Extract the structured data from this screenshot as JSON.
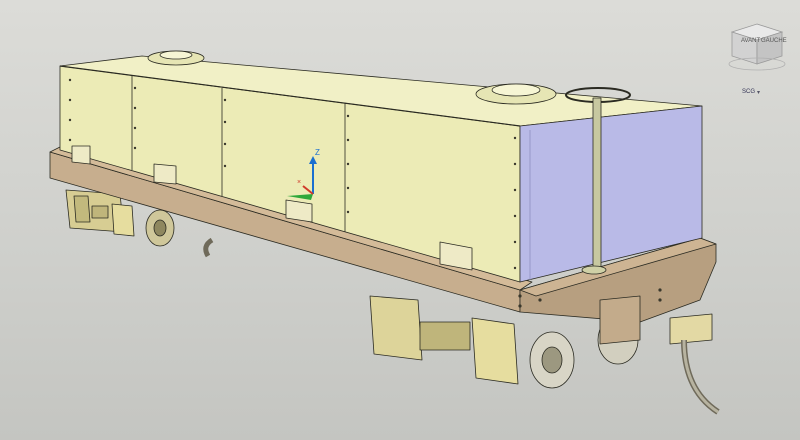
{
  "viewcube": {
    "face_left": "AVANT",
    "face_right": "GAUCHE"
  },
  "wcs_menu": {
    "label": "SCG",
    "chevron": "▾"
  },
  "ucs": {
    "z_label": "Z"
  },
  "icons": {
    "viewcube": "viewcube-icon",
    "ucs": "ucs-axis-icon",
    "chevron": "chevron-down-icon"
  },
  "colors": {
    "background": "#d3d4d0",
    "tank": "#ecebb6",
    "tank_end": "#b7b8e6",
    "frame": "#bda689",
    "bogie": "#ddd49a",
    "edges": "#2b2b22"
  }
}
